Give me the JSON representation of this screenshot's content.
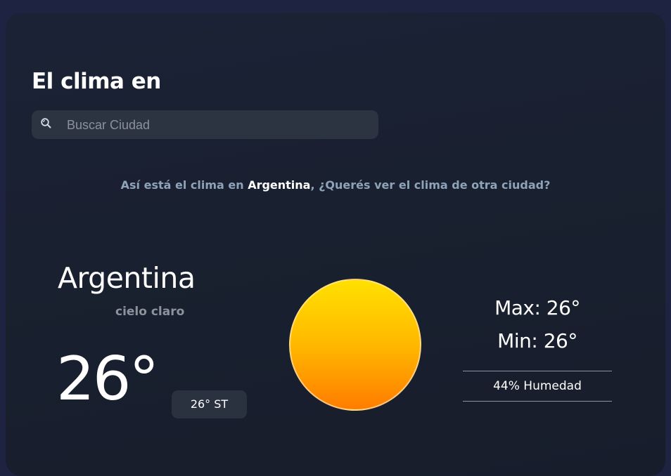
{
  "header": {
    "title": "El clima en"
  },
  "search": {
    "placeholder": "Buscar Ciudad",
    "value": ""
  },
  "info": {
    "prefix": "Así está el clima en ",
    "country": "Argentina",
    "separator": ",",
    "cta": " ¿Querés ver el clima de otra ciudad?"
  },
  "weather": {
    "city": "Argentina",
    "condition": "cielo claro",
    "temperature": "26°",
    "feels_like": "26° ST",
    "max": "Max: 26°",
    "min": "Min: 26°",
    "humidity": "44% Humedad",
    "icon": "sun-icon"
  },
  "colors": {
    "background": "#1f2342",
    "card": "#19202f",
    "accent_text": "#8fa3b8",
    "sun_top": "#ffe000",
    "sun_bottom": "#ff7c00"
  }
}
